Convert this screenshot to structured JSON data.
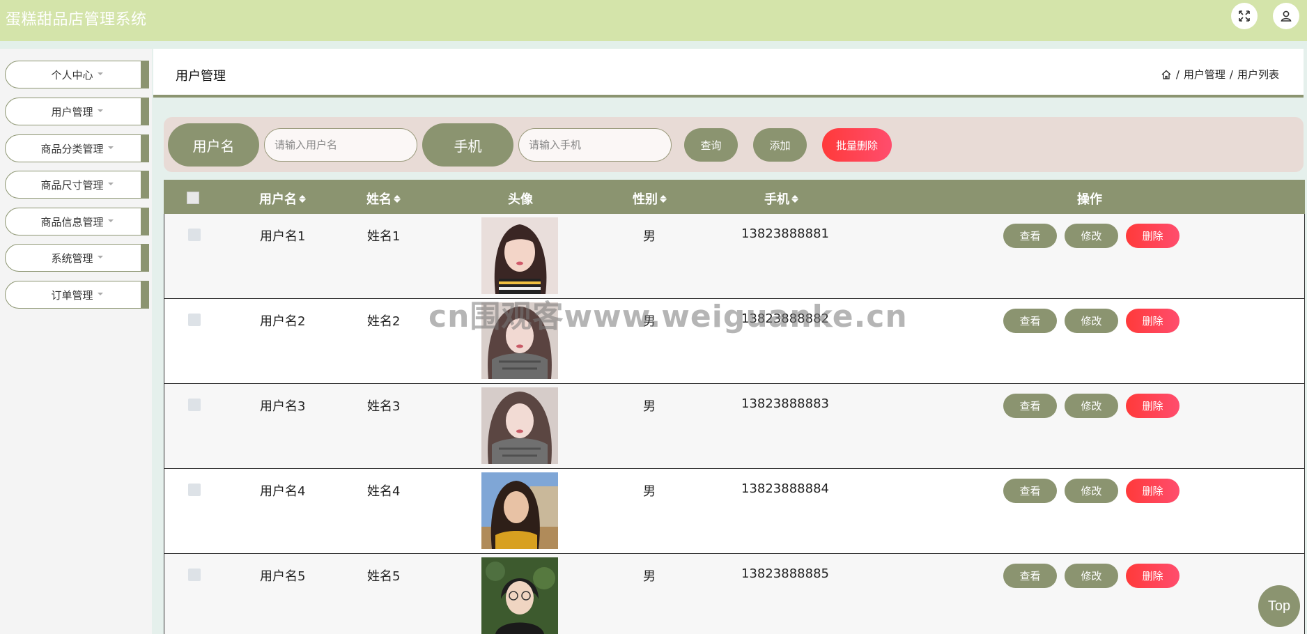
{
  "app": {
    "title": "蛋糕甜品店管理系统"
  },
  "header": {
    "fullscreen_icon": "expand-icon",
    "user_icon": "user-icon"
  },
  "sidebar": {
    "items": [
      {
        "label": "个人中心"
      },
      {
        "label": "用户管理"
      },
      {
        "label": "商品分类管理"
      },
      {
        "label": "商品尺寸管理"
      },
      {
        "label": "商品信息管理"
      },
      {
        "label": "系统管理"
      },
      {
        "label": "订单管理"
      }
    ]
  },
  "page": {
    "title": "用户管理",
    "breadcrumb": {
      "home_icon": "home-icon",
      "sep": "/",
      "level1": "用户管理",
      "level2": "用户列表"
    }
  },
  "search": {
    "username_label": "用户名",
    "username_placeholder": "请输入用户名",
    "username_value": "",
    "phone_label": "手机",
    "phone_placeholder": "请输入手机",
    "phone_value": "",
    "query_label": "查询",
    "add_label": "添加",
    "batch_delete_label": "批量删除"
  },
  "table": {
    "headers": {
      "username": "用户名",
      "name": "姓名",
      "avatar": "头像",
      "gender": "性别",
      "phone": "手机",
      "actions": "操作"
    },
    "rows": [
      {
        "username": "用户名1",
        "name": "姓名1",
        "gender": "男",
        "phone": "13823888881",
        "view": "查看",
        "edit": "修改",
        "delete": "删除"
      },
      {
        "username": "用户名2",
        "name": "姓名2",
        "gender": "男",
        "phone": "13823888882",
        "view": "查看",
        "edit": "修改",
        "delete": "删除"
      },
      {
        "username": "用户名3",
        "name": "姓名3",
        "gender": "男",
        "phone": "13823888883",
        "view": "查看",
        "edit": "修改",
        "delete": "删除"
      },
      {
        "username": "用户名4",
        "name": "姓名4",
        "gender": "男",
        "phone": "13823888884",
        "view": "查看",
        "edit": "修改",
        "delete": "删除"
      },
      {
        "username": "用户名5",
        "name": "姓名5",
        "gender": "男",
        "phone": "13823888885",
        "view": "查看",
        "edit": "修改",
        "delete": "删除"
      }
    ]
  },
  "watermark": "cn围观客www.weiguanke.cn",
  "back_to_top": "Top",
  "colors": {
    "header_bg": "#d4e4aa",
    "accent": "#8b9470",
    "danger": "#ff4d4f",
    "search_bg": "#e8dbd6"
  }
}
